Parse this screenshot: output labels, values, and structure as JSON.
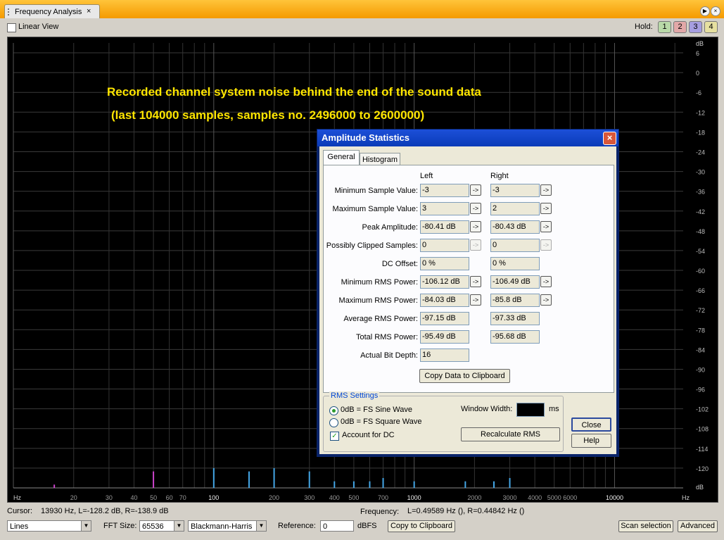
{
  "window": {
    "tab_title": "Frequency Analysis",
    "tab_close": "×"
  },
  "toolbar": {
    "linear_view_label": "Linear View",
    "hold_label": "Hold:",
    "hold_buttons": [
      {
        "label": "1",
        "color": "#b9d9a8"
      },
      {
        "label": "2",
        "color": "#e3a8a8"
      },
      {
        "label": "3",
        "color": "#a69ee0"
      },
      {
        "label": "4",
        "color": "#e6e0a0"
      }
    ]
  },
  "plot": {
    "annotation_line1": "Recorded channel system noise behind the end of the sound data",
    "annotation_line2": "(last 104000 samples, samples no. 2496000 to 2600000)",
    "db_label_top": "dB",
    "db_label_bottom": "dB",
    "db_ticks": [
      "6",
      "0",
      "-6",
      "-12",
      "-18",
      "-24",
      "-30",
      "-36",
      "-42",
      "-48",
      "-54",
      "-60",
      "-66",
      "-72",
      "-78",
      "-84",
      "-90",
      "-96",
      "-102",
      "-108",
      "-114",
      "-120"
    ],
    "hz_label_left": "Hz",
    "hz_label_right": "Hz",
    "freq_ticks": [
      "20",
      "30",
      "40",
      "50",
      "60",
      "70",
      "100",
      "200",
      "300",
      "400",
      "500",
      "700",
      "1000",
      "2000",
      "3000",
      "4000",
      "5000",
      "6000",
      "10000"
    ]
  },
  "chart_data": {
    "type": "line",
    "title": "",
    "xlabel": "Hz",
    "ylabel": "dB",
    "x_scale": "log",
    "xlim": [
      10,
      22000
    ],
    "ylim": [
      -126,
      9
    ],
    "series": [
      {
        "color": "#cc44cc",
        "x": [
          16,
          50
        ],
        "y": [
          -125,
          -121
        ]
      },
      {
        "color": "#44a6e6",
        "x": [
          100,
          150,
          200,
          300,
          400,
          500,
          600,
          700,
          1000,
          1800,
          2500,
          3000
        ],
        "y": [
          -120,
          -121,
          -120,
          -121,
          -124,
          -124,
          -124,
          -123,
          -124,
          -124,
          -124,
          -123
        ]
      }
    ]
  },
  "status": {
    "cursor_label": "Cursor:",
    "cursor_value": "13930 Hz, L=-128.2 dB, R=-138.9 dB",
    "frequency_label": "Frequency:",
    "frequency_value": "L=0.49589 Hz (), R=0.44842 Hz ()"
  },
  "controls": {
    "display_mode": "Lines",
    "fft_size_label": "FFT Size:",
    "fft_size": "65536",
    "window": "Blackmann-Harris",
    "reference_label": "Reference:",
    "reference_value": "0",
    "reference_unit": "dBFS",
    "copy_clipboard": "Copy to Clipboard",
    "scan_selection": "Scan selection",
    "advanced": "Advanced"
  },
  "dialog": {
    "title": "Amplitude Statistics",
    "tabs": [
      "General",
      "Histogram"
    ],
    "col_left": "Left",
    "col_right": "Right",
    "rows": [
      {
        "label": "Minimum Sample Value:",
        "left": "-3",
        "right": "-3",
        "go": true
      },
      {
        "label": "Maximum Sample Value:",
        "left": "3",
        "right": "2",
        "go": true
      },
      {
        "label": "Peak Amplitude:",
        "left": "-80.41 dB",
        "right": "-80.43 dB",
        "go": true
      },
      {
        "label": "Possibly Clipped Samples:",
        "left": "0",
        "right": "0",
        "go": true
      },
      {
        "label": "DC Offset:",
        "left": "0 %",
        "right": "0 %",
        "go": false
      },
      {
        "label": "Minimum RMS Power:",
        "left": "-106.12 dB",
        "right": "-106.49 dB",
        "go": true
      },
      {
        "label": "Maximum RMS Power:",
        "left": "-84.03 dB",
        "right": "-85.8 dB",
        "go": true
      },
      {
        "label": "Average RMS Power:",
        "left": "-97.15 dB",
        "right": "-97.33 dB",
        "go": false
      },
      {
        "label": "Total RMS Power:",
        "left": "-95.49 dB",
        "right": "-95.68 dB",
        "go": false
      },
      {
        "label": "Actual Bit Depth:",
        "left": "16",
        "go": false
      }
    ],
    "go_symbol": "->",
    "copy_button": "Copy Data to Clipboard",
    "rms_group_label": "RMS Settings",
    "radio_sine": "0dB = FS Sine Wave",
    "radio_square": "0dB = FS Square Wave",
    "account_dc": "Account for DC",
    "account_dc_check": "✓",
    "window_width_label": "Window Width:",
    "window_width_unit": "ms",
    "recalculate": "Recalculate RMS",
    "close": "Close",
    "help": "Help"
  }
}
